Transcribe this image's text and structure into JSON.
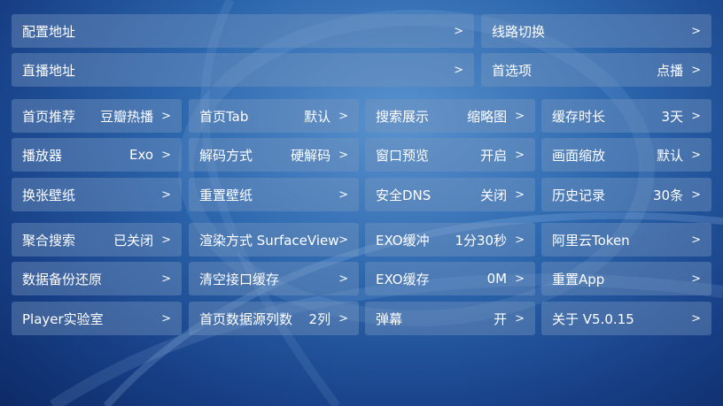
{
  "top_rows": [
    [
      {
        "label": "配置地址",
        "value": "",
        "name": "config-address"
      },
      {
        "label": "线路切换",
        "value": "",
        "name": "line-switch"
      }
    ],
    [
      {
        "label": "直播地址",
        "value": "",
        "name": "live-address"
      },
      {
        "label": "首选项",
        "value": "点播",
        "name": "preference"
      }
    ]
  ],
  "grid_rows": [
    [
      {
        "label": "首页推荐",
        "value": "豆瓣热播",
        "name": "home-recommend"
      },
      {
        "label": "首页Tab",
        "value": "默认",
        "name": "home-tab"
      },
      {
        "label": "搜索展示",
        "value": "缩略图",
        "name": "search-display"
      },
      {
        "label": "缓存时长",
        "value": "3天",
        "name": "cache-duration"
      }
    ],
    [
      {
        "label": "播放器",
        "value": "Exo",
        "name": "player"
      },
      {
        "label": "解码方式",
        "value": "硬解码",
        "name": "decode-mode"
      },
      {
        "label": "窗口预览",
        "value": "开启",
        "name": "window-preview"
      },
      {
        "label": "画面缩放",
        "value": "默认",
        "name": "picture-scale"
      }
    ],
    [
      {
        "label": "换张壁纸",
        "value": "",
        "name": "change-wallpaper"
      },
      {
        "label": "重置壁纸",
        "value": "",
        "name": "reset-wallpaper"
      },
      {
        "label": "安全DNS",
        "value": "关闭",
        "name": "secure-dns"
      },
      {
        "label": "历史记录",
        "value": "30条",
        "name": "history"
      }
    ],
    [
      {
        "label": "聚合搜索",
        "value": "已关闭",
        "name": "aggregate-search"
      },
      {
        "label": "渲染方式 SurfaceView",
        "value": "",
        "name": "render-mode"
      },
      {
        "label": "EXO缓冲",
        "value": "1分30秒",
        "name": "exo-buffer"
      },
      {
        "label": "阿里云Token",
        "value": "",
        "name": "aliyun-token"
      }
    ],
    [
      {
        "label": "数据备份还原",
        "value": "",
        "name": "data-backup"
      },
      {
        "label": "清空接口缓存",
        "value": "",
        "name": "clear-api-cache"
      },
      {
        "label": "EXO缓存",
        "value": "0M",
        "name": "exo-cache"
      },
      {
        "label": "重置App",
        "value": "",
        "name": "reset-app"
      }
    ],
    [
      {
        "label": "Player实验室",
        "value": "",
        "name": "player-lab"
      },
      {
        "label": "首页数据源列数",
        "value": "2列",
        "name": "home-source-columns"
      },
      {
        "label": "弹幕",
        "value": "开",
        "name": "danmaku"
      },
      {
        "label": "关于  V5.0.15",
        "value": "",
        "name": "about"
      }
    ]
  ],
  "chevron": ">"
}
